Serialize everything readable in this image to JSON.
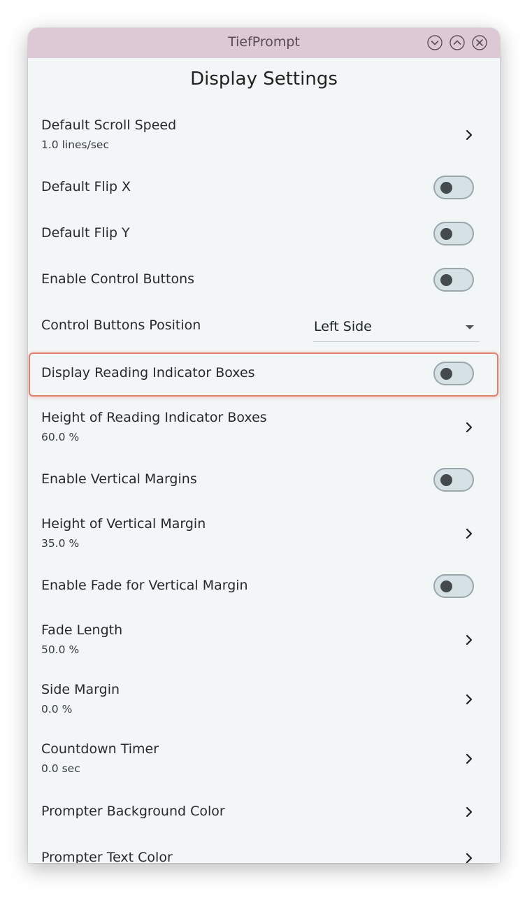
{
  "window": {
    "title": "TiefPrompt",
    "buttons": [
      "minimize",
      "maximize",
      "close"
    ]
  },
  "page": {
    "heading": "Display Settings"
  },
  "settings": [
    {
      "label": "Default Scroll Speed",
      "value": "1.0 lines/sec",
      "control": "chevron"
    },
    {
      "label": "Default Flip X",
      "control": "toggle",
      "on": false
    },
    {
      "label": "Default Flip Y",
      "control": "toggle",
      "on": false
    },
    {
      "label": "Enable Control Buttons",
      "control": "toggle",
      "on": false
    },
    {
      "label": "Control Buttons Position",
      "control": "dropdown",
      "selected": "Left Side"
    },
    {
      "label": "Display Reading Indicator Boxes",
      "control": "toggle",
      "on": false,
      "highlighted": true
    },
    {
      "label": "Height of Reading Indicator Boxes",
      "value": "60.0 %",
      "control": "chevron"
    },
    {
      "label": "Enable Vertical Margins",
      "control": "toggle",
      "on": false
    },
    {
      "label": "Height of Vertical Margin",
      "value": "35.0 %",
      "control": "chevron"
    },
    {
      "label": "Enable Fade for Vertical Margin",
      "control": "toggle",
      "on": false
    },
    {
      "label": "Fade Length",
      "value": "50.0 %",
      "control": "chevron"
    },
    {
      "label": "Side Margin",
      "value": "0.0 %",
      "control": "chevron"
    },
    {
      "label": "Countdown Timer",
      "value": "0.0 sec",
      "control": "chevron"
    },
    {
      "label": "Prompter Background Color",
      "control": "chevron"
    },
    {
      "label": "Prompter Text Color",
      "control": "chevron"
    }
  ],
  "colors": {
    "titlebar": "#dcc9d5",
    "background": "#f2f6f7",
    "highlight": "#e37f69",
    "toggle_off": "#d5e1e5"
  }
}
